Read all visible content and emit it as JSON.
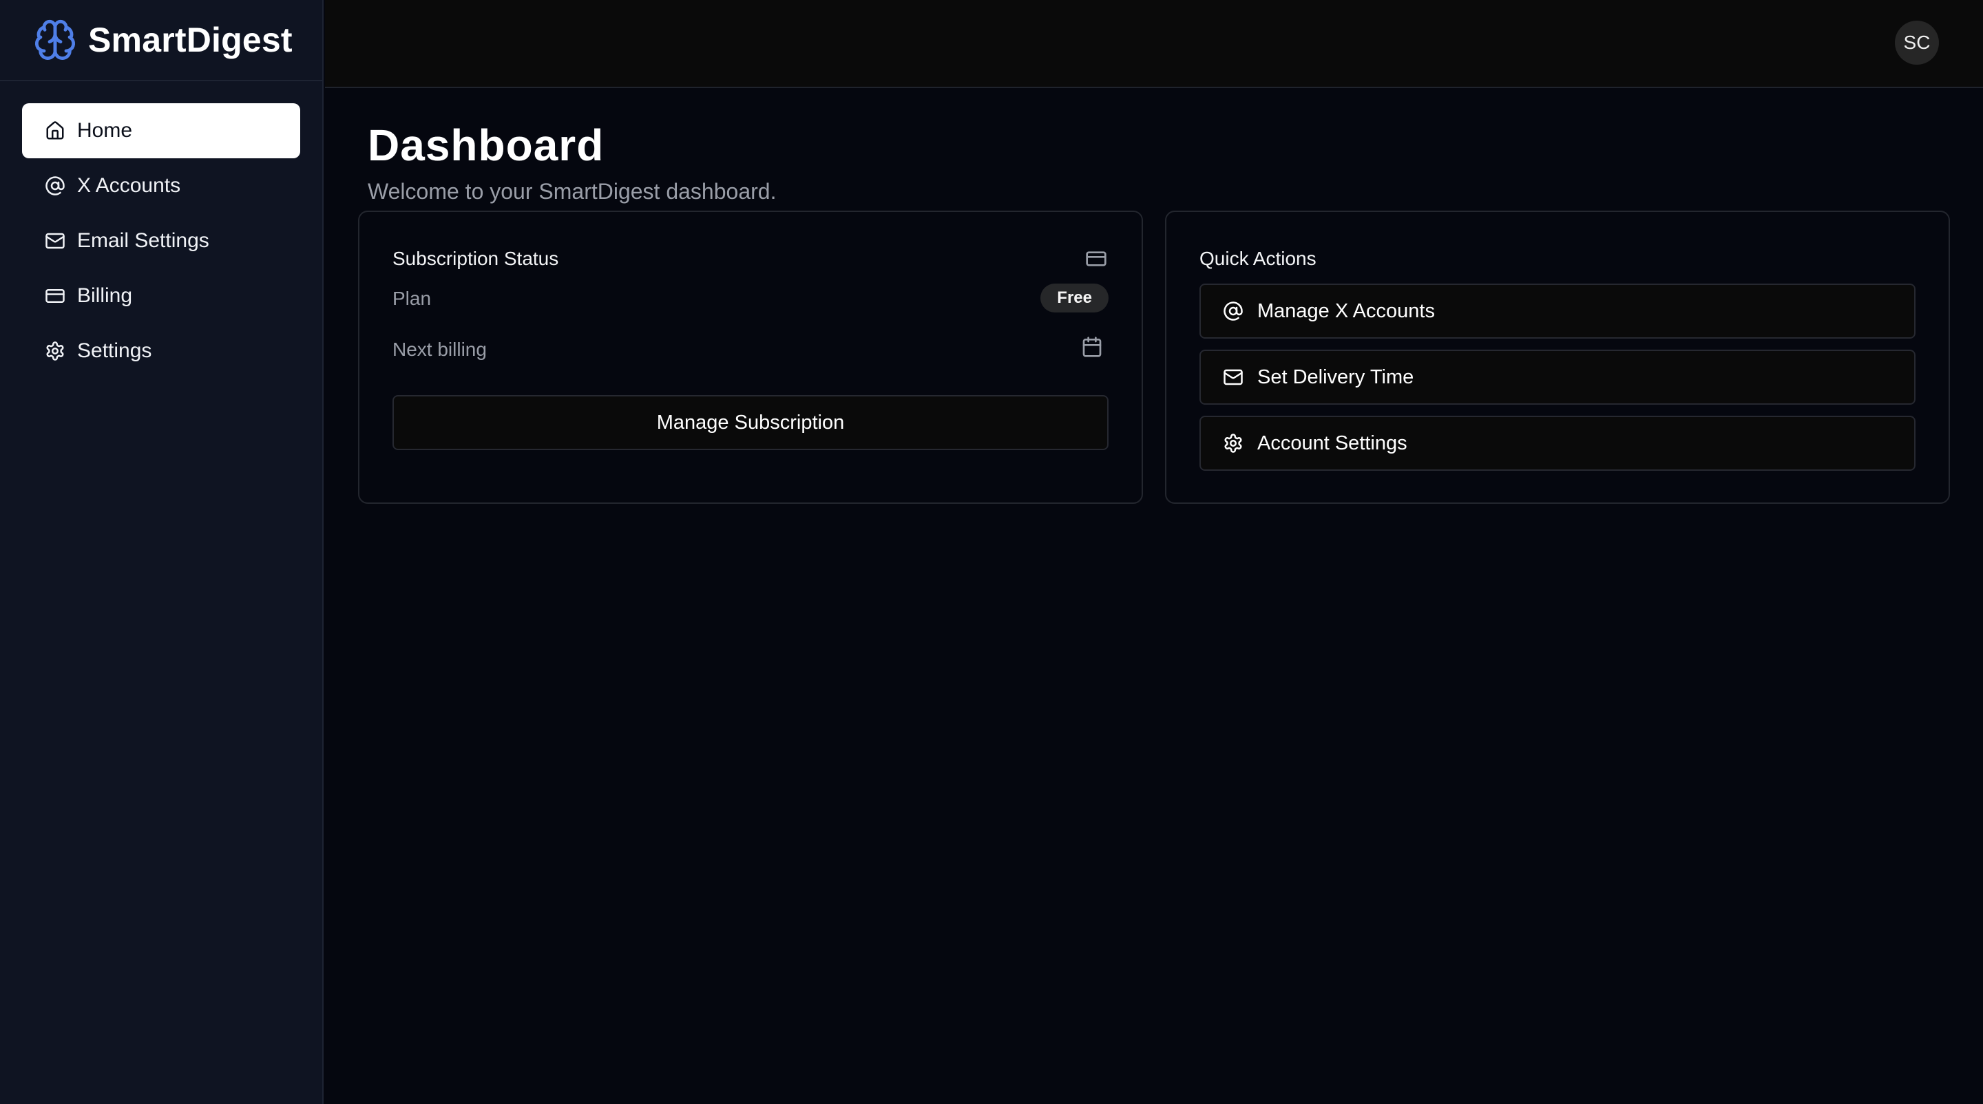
{
  "app": {
    "name": "SmartDigest"
  },
  "colors": {
    "accent": "#4f7fe8",
    "background": "#05070f",
    "sidebar": "#0f1422"
  },
  "sidebar": {
    "items": [
      {
        "label": "Home",
        "icon": "home-icon",
        "active": true
      },
      {
        "label": "X Accounts",
        "icon": "at-sign-icon",
        "active": false
      },
      {
        "label": "Email Settings",
        "icon": "mail-icon",
        "active": false
      },
      {
        "label": "Billing",
        "icon": "credit-card-icon",
        "active": false
      },
      {
        "label": "Settings",
        "icon": "gear-icon",
        "active": false
      }
    ]
  },
  "header": {
    "avatar_initials": "SC"
  },
  "main": {
    "title": "Dashboard",
    "subtitle": "Welcome to your SmartDigest dashboard."
  },
  "subscription": {
    "title": "Subscription Status",
    "plan_label": "Plan",
    "plan_value": "Free",
    "next_billing_label": "Next billing",
    "button_label": "Manage Subscription"
  },
  "quick_actions": {
    "title": "Quick Actions",
    "items": [
      {
        "label": "Manage X Accounts",
        "icon": "at-sign-icon"
      },
      {
        "label": "Set Delivery Time",
        "icon": "mail-icon"
      },
      {
        "label": "Account Settings",
        "icon": "gear-icon"
      }
    ]
  }
}
